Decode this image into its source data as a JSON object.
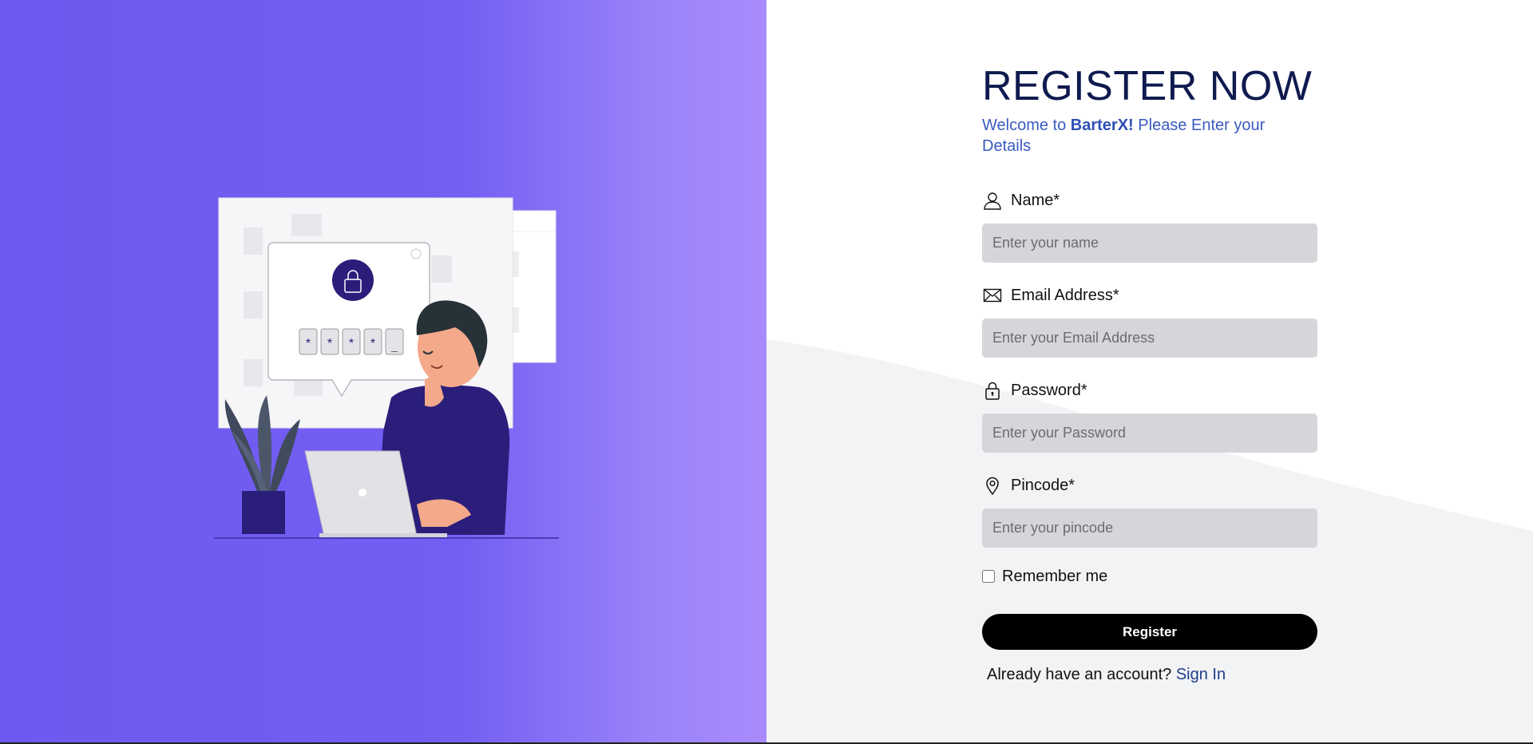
{
  "header": {
    "title": "REGISTER NOW",
    "welcome_prefix": "Welcome to",
    "brand": "BarterX!",
    "welcome_suffix": "Please Enter your Details"
  },
  "form": {
    "fields": [
      {
        "label": "Name*",
        "placeholder": "Enter your name",
        "icon": "user-icon"
      },
      {
        "label": "Email Address*",
        "placeholder": "Enter your Email Address",
        "icon": "envelope-icon"
      },
      {
        "label": "Password*",
        "placeholder": "Enter your Password",
        "icon": "lock-icon"
      },
      {
        "label": "Pincode*",
        "placeholder": "Enter your pincode",
        "icon": "location-pin-icon"
      }
    ],
    "remember_label": "Remember me",
    "remember_checked": false,
    "submit_label": "Register",
    "signin_prompt": "Already have an account?",
    "signin_link": "Sign In"
  },
  "illustration": {
    "password_mask_chars": [
      "*",
      "*",
      "*",
      "*",
      "_"
    ]
  },
  "colors": {
    "left_gradient_start": "#6e59f0",
    "left_gradient_end": "#a98bfd",
    "title": "#0f1a4f",
    "subtitle": "#3a5bbf",
    "input_bg": "#d5d6d9",
    "button_bg": "#000000",
    "link": "#1d3e88"
  }
}
